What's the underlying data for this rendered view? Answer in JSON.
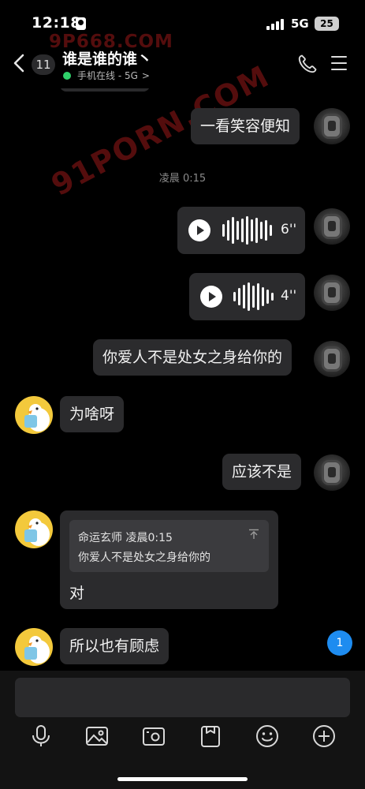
{
  "status_bar": {
    "time": "12:18",
    "network": "5G",
    "battery": "25"
  },
  "header": {
    "back_label": "<",
    "unread_count": "11",
    "title": "谁是谁的谁丶",
    "subtitle": "手机在线 - 5G",
    "online_color": "#2fd06a"
  },
  "watermarks": [
    "9P668.COM",
    "91PORN.COM"
  ],
  "messages": [
    {
      "side": "right",
      "type": "text",
      "text": "一看笑容便知"
    },
    {
      "type": "time",
      "text": "凌晨 0:15"
    },
    {
      "side": "right",
      "type": "voice",
      "duration": "6''"
    },
    {
      "side": "right",
      "type": "voice",
      "duration": "4''"
    },
    {
      "side": "right",
      "type": "text",
      "text": "你爱人不是处女之身给你的"
    },
    {
      "side": "left",
      "type": "text",
      "text": "为啥呀"
    },
    {
      "side": "right",
      "type": "text",
      "text": "应该不是"
    },
    {
      "side": "left",
      "type": "quote",
      "quote_author": "命运玄师",
      "quote_time": "凌晨0:15",
      "quote_text": "你爱人不是处女之身给你的",
      "text": "对"
    },
    {
      "side": "left",
      "type": "text",
      "text": "所以也有顾虑"
    }
  ],
  "new_message_badge": "1",
  "composer": {
    "placeholder": "",
    "tools": [
      "microphone-icon",
      "image-icon",
      "camera-icon",
      "file-icon",
      "emoji-icon",
      "plus-icon"
    ]
  },
  "colors": {
    "background": "#000000",
    "bubble": "#2b2b2d",
    "badge_blue": "#1e8cf0"
  }
}
